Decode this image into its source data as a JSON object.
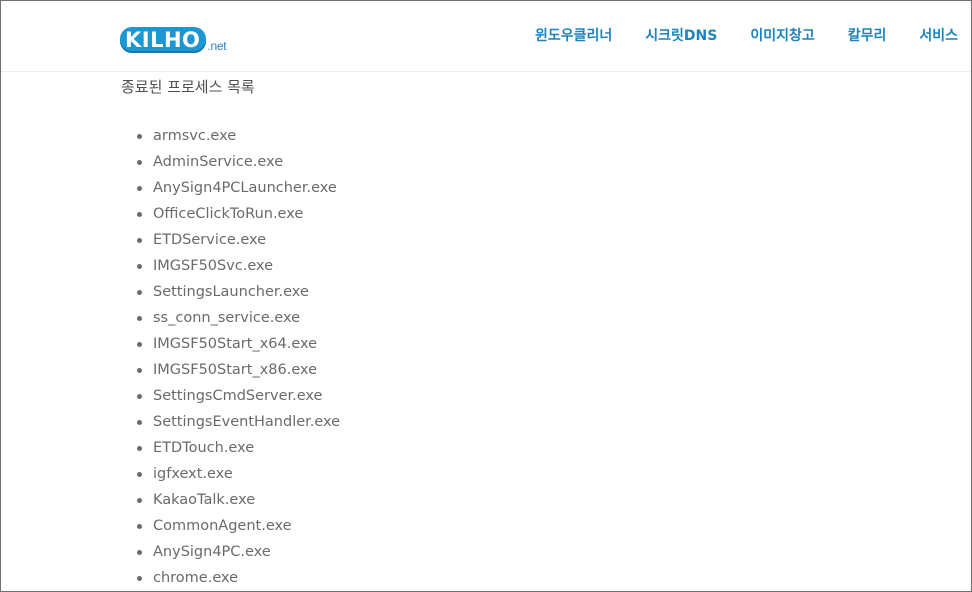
{
  "header": {
    "logo": {
      "main": "KILHO",
      "sub": ".net"
    },
    "nav": [
      {
        "label": "윈도우클리너"
      },
      {
        "label": "시크릿DNS"
      },
      {
        "label": "이미지창고"
      },
      {
        "label": "칼무리"
      },
      {
        "label": "서비스"
      }
    ]
  },
  "main": {
    "title": "종료된 프로세스 목록",
    "processes": [
      "armsvc.exe",
      "AdminService.exe",
      "AnySign4PCLauncher.exe",
      "OfficeClickToRun.exe",
      "ETDService.exe",
      "IMGSF50Svc.exe",
      "SettingsLauncher.exe",
      "ss_conn_service.exe",
      "IMGSF50Start_x64.exe",
      "IMGSF50Start_x86.exe",
      "SettingsCmdServer.exe",
      "SettingsEventHandler.exe",
      "ETDTouch.exe",
      "igfxext.exe",
      "KakaoTalk.exe",
      "CommonAgent.exe",
      "AnySign4PC.exe",
      "chrome.exe"
    ]
  },
  "colors": {
    "brand": "#1c97d3",
    "nav_text": "#1d83bd",
    "body_text": "#6a6a6a"
  }
}
